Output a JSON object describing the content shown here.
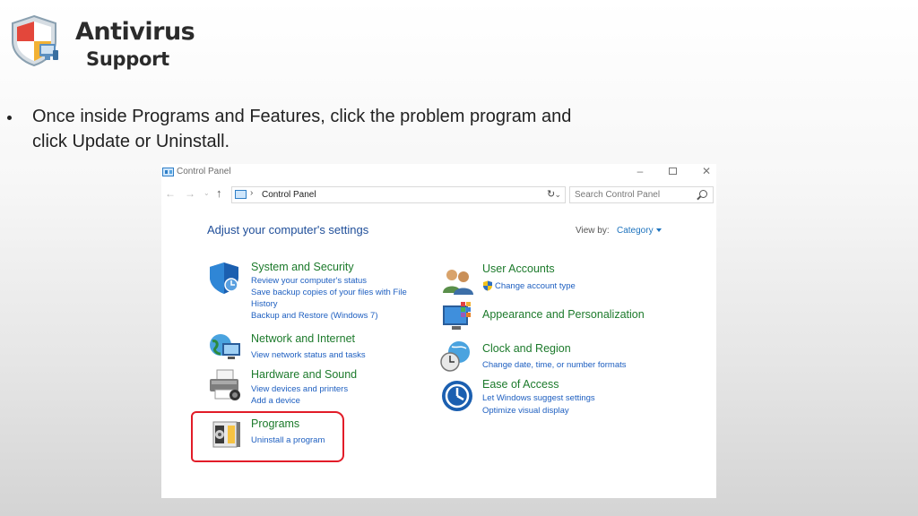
{
  "logo": {
    "line1": "Antivirus",
    "line2": "Support",
    "shield_colors": [
      "#e3473b",
      "#f2b134",
      "#5c8fbf"
    ]
  },
  "bullet": {
    "text": "Once inside Programs and Features, click the problem program and click Update or Uninstall."
  },
  "window": {
    "title": "Control Panel",
    "controls": {
      "minimize": "–",
      "maximize": "",
      "close": "✕"
    },
    "nav": {
      "back": "←",
      "forward": "→",
      "dropdown": "⌄",
      "up": "↑"
    },
    "address": {
      "separator": "›",
      "path": "Control Panel"
    },
    "search_placeholder": "Search Control Panel",
    "heading": "Adjust your computer's settings",
    "view_by_label": "View by:",
    "view_by_value": "Category"
  },
  "categories": {
    "system_security": {
      "title": "System and Security",
      "links": [
        "Review your computer's status",
        "Save backup copies of your files with File",
        "History",
        "Backup and Restore (Windows 7)"
      ]
    },
    "network": {
      "title": "Network and Internet",
      "links": [
        "View network status and tasks"
      ]
    },
    "hardware": {
      "title": "Hardware and Sound",
      "links": [
        "View devices and printers",
        "Add a device"
      ]
    },
    "programs": {
      "title": "Programs",
      "links": [
        "Uninstall a program"
      ]
    },
    "user_accounts": {
      "title": "User Accounts",
      "links": [
        "Change account type"
      ]
    },
    "appearance": {
      "title": "Appearance and Personalization",
      "links": []
    },
    "clock": {
      "title": "Clock and Region",
      "links": [
        "Change date, time, or number formats"
      ]
    },
    "ease": {
      "title": "Ease of Access",
      "links": [
        "Let Windows suggest settings",
        "Optimize visual display"
      ]
    }
  },
  "colors": {
    "category_title": "#1c7a2b",
    "link": "#1e5fc0",
    "heading": "#1f4e99",
    "highlight": "#e21c28"
  }
}
